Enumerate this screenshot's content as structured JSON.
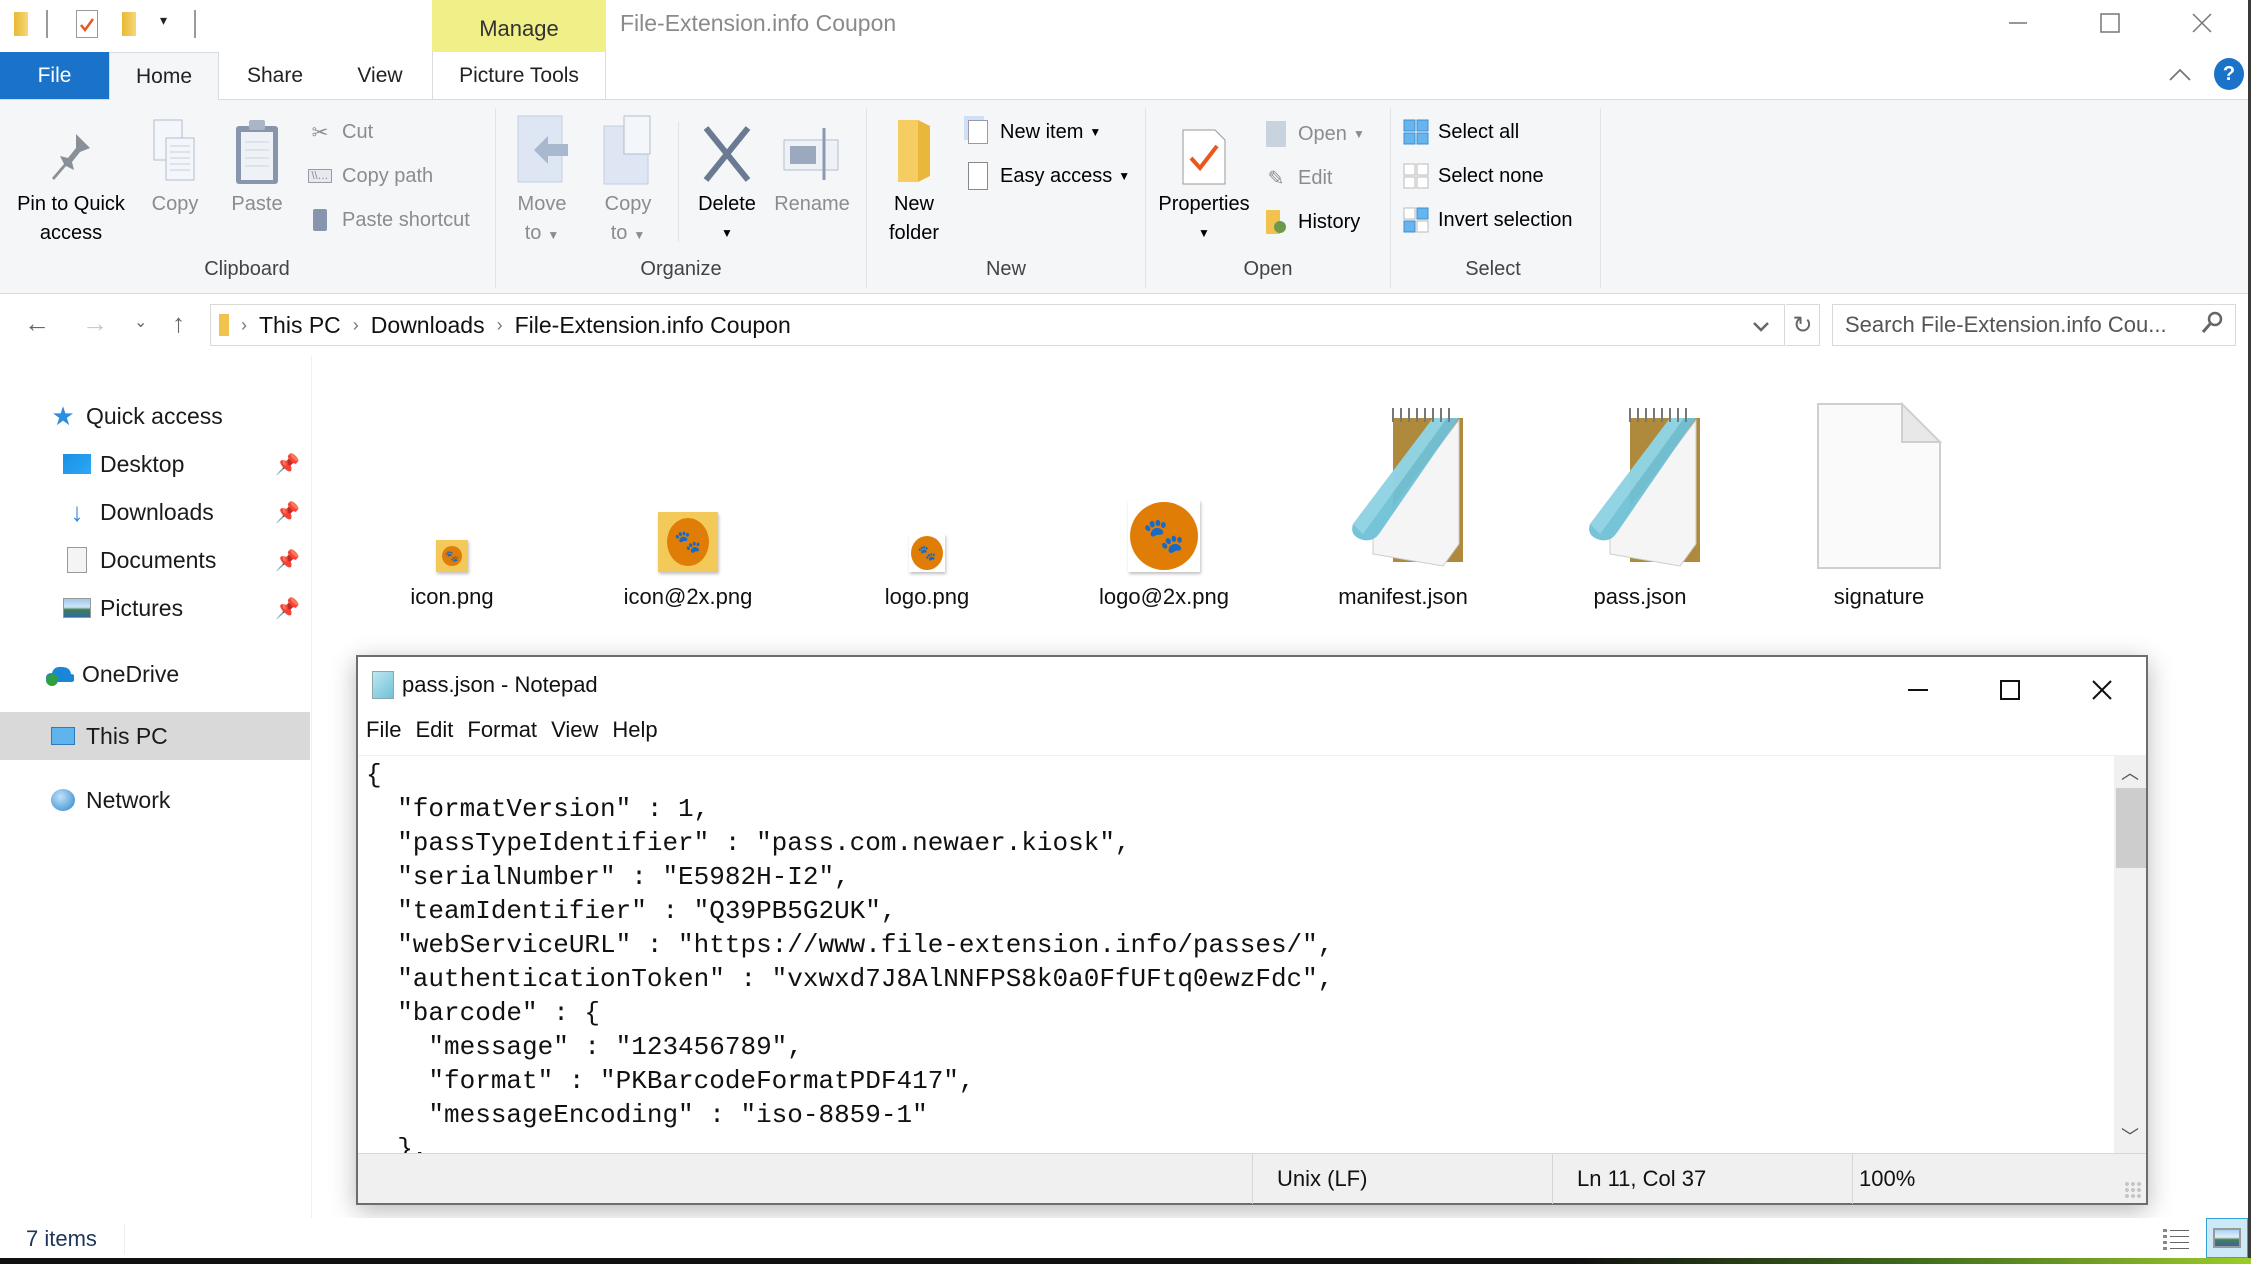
{
  "window": {
    "title": "File-Extension.info Coupon",
    "contextual_tab_group": "Manage",
    "controls": {
      "minimize": "—",
      "maximize": "☐",
      "close": "✕"
    }
  },
  "quick_access_toolbar": {
    "icons": [
      "folder-icon",
      "properties-check-icon",
      "new-folder-icon",
      "customize-dropdown-icon"
    ]
  },
  "ribbon": {
    "tabs": [
      {
        "label": "File",
        "active": false
      },
      {
        "label": "Home",
        "active": true
      },
      {
        "label": "Share",
        "active": false
      },
      {
        "label": "View",
        "active": false
      },
      {
        "label": "Picture Tools",
        "active": false
      }
    ],
    "help_label": "?",
    "collapse_label": "∧",
    "groups": {
      "clipboard": {
        "label": "Clipboard",
        "pin_to_quick_access": "Pin to Quick access",
        "pin_line1": "Pin to Quick",
        "pin_line2": "access",
        "copy": "Copy",
        "paste": "Paste",
        "cut": "Cut",
        "copy_path": "Copy path",
        "paste_shortcut": "Paste shortcut"
      },
      "organize": {
        "label": "Organize",
        "move_to_line1": "Move",
        "move_to_line2": "to",
        "copy_to_line1": "Copy",
        "copy_to_line2": "to",
        "delete": "Delete",
        "rename": "Rename"
      },
      "new": {
        "label": "New",
        "new_folder_line1": "New",
        "new_folder_line2": "folder",
        "new_item": "New item",
        "easy_access": "Easy access"
      },
      "open": {
        "label": "Open",
        "properties": "Properties",
        "open": "Open",
        "edit": "Edit",
        "history": "History"
      },
      "select": {
        "label": "Select",
        "select_all": "Select all",
        "select_none": "Select none",
        "invert_selection": "Invert selection"
      }
    }
  },
  "address_bar": {
    "breadcrumbs": [
      "This PC",
      "Downloads",
      "File-Extension.info Coupon"
    ],
    "search_placeholder": "Search File-Extension.info Cou..."
  },
  "nav_pane": {
    "items": [
      {
        "label": "Quick access",
        "icon": "quick-access-star-icon",
        "pinned": false,
        "selected": false
      },
      {
        "label": "Desktop",
        "icon": "desktop-icon",
        "pinned": true,
        "selected": false
      },
      {
        "label": "Downloads",
        "icon": "downloads-arrow-icon",
        "pinned": true,
        "selected": false
      },
      {
        "label": "Documents",
        "icon": "documents-icon",
        "pinned": true,
        "selected": false
      },
      {
        "label": "Pictures",
        "icon": "pictures-icon",
        "pinned": true,
        "selected": false
      },
      {
        "label": "OneDrive",
        "icon": "onedrive-cloud-icon",
        "pinned": false,
        "selected": false
      },
      {
        "label": "This PC",
        "icon": "this-pc-icon",
        "pinned": false,
        "selected": true
      },
      {
        "label": "Network",
        "icon": "network-icon",
        "pinned": false,
        "selected": false
      }
    ]
  },
  "files": [
    {
      "name": "icon.png",
      "type": "png-thumbnail"
    },
    {
      "name": "icon@2x.png",
      "type": "png-thumbnail"
    },
    {
      "name": "logo.png",
      "type": "png-thumbnail"
    },
    {
      "name": "logo@2x.png",
      "type": "png-thumbnail"
    },
    {
      "name": "manifest.json",
      "type": "notepad-document"
    },
    {
      "name": "pass.json",
      "type": "notepad-document"
    },
    {
      "name": "signature",
      "type": "blank-file"
    }
  ],
  "notepad": {
    "title": "pass.json - Notepad",
    "menu": [
      "File",
      "Edit",
      "Format",
      "View",
      "Help"
    ],
    "lines": [
      "{",
      "  \"formatVersion\" : 1,",
      "  \"passTypeIdentifier\" : \"pass.com.newaer.kiosk\",",
      "  \"serialNumber\" : \"E5982H-I2\",",
      "  \"teamIdentifier\" : \"Q39PB5G2UK\",",
      "  \"webServiceURL\" : \"https://www.file-extension.info/passes/\",",
      "  \"authenticationToken\" : \"vxwxd7J8AlNNFPS8k0a0FfUFtq0ewzFdc\",",
      "  \"barcode\" : {",
      "    \"message\" : \"123456789\",",
      "    \"format\" : \"PKBarcodeFormatPDF417\",",
      "    \"messageEncoding\" : \"iso-8859-1\"",
      "  },"
    ],
    "status": {
      "line_endings": "Unix (LF)",
      "position": "Ln 11, Col 37",
      "zoom": "100%"
    }
  },
  "status_bar": {
    "item_count": "7 items"
  },
  "colors": {
    "accent": "#1a73c8",
    "manage_tab": "#f1ef88",
    "ribbon_bg": "#f5f6f7",
    "nav_selected": "#d9d9d9",
    "paw_orange": "#e07d06",
    "icon_tile_yellow": "#f3c95a"
  }
}
